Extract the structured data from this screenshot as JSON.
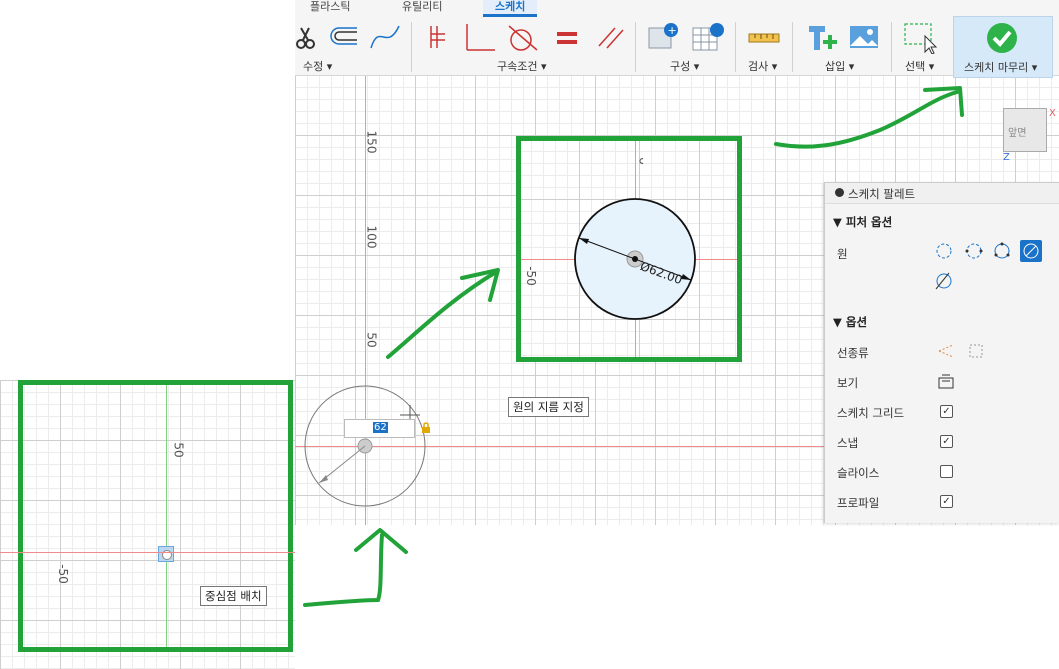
{
  "toolbar": {
    "tabs": [
      "플라스틱",
      "유틸리티",
      "스케치"
    ],
    "groups": {
      "modify": "수정",
      "constraints": "구속조건",
      "configure": "구성",
      "inspect": "검사",
      "insert": "삽입",
      "select": "선택",
      "finish": "스케치 마무리"
    },
    "dropdown_caret": "▾"
  },
  "canvas": {
    "ruler_labels": [
      "150",
      "100",
      "50"
    ],
    "dimension_input_value": "62",
    "diameter_dimension": "Ø62.00",
    "inset_top_left_label": "-50",
    "inset_top_glyph": "ᴗ",
    "inset_bottom_top_label": "50",
    "inset_bottom_left_label": "-50"
  },
  "tooltips": {
    "specify_diameter": "원의 지름 지정",
    "place_center": "중심점 배치"
  },
  "palette": {
    "title": "스케치 팔레트",
    "feature_options": {
      "heading": "피처 옵션",
      "row_label": "원"
    },
    "options": {
      "heading": "옵션",
      "rows": [
        {
          "label": "선종류",
          "kind": "icons"
        },
        {
          "label": "보기",
          "kind": "icon"
        },
        {
          "label": "스케치 그리드",
          "kind": "checkbox",
          "checked": true
        },
        {
          "label": "스냅",
          "kind": "checkbox",
          "checked": true
        },
        {
          "label": "슬라이스",
          "kind": "checkbox",
          "checked": false
        },
        {
          "label": "프로파일",
          "kind": "checkbox",
          "checked": true
        }
      ]
    },
    "check_mark": "✓"
  },
  "viewcube": {
    "face": "앞면",
    "axis_x": "X",
    "axis_z": "Z"
  },
  "colors": {
    "accent": "#1a73c9",
    "highlight_box": "#22a339",
    "finish_check": "#2db34a"
  }
}
